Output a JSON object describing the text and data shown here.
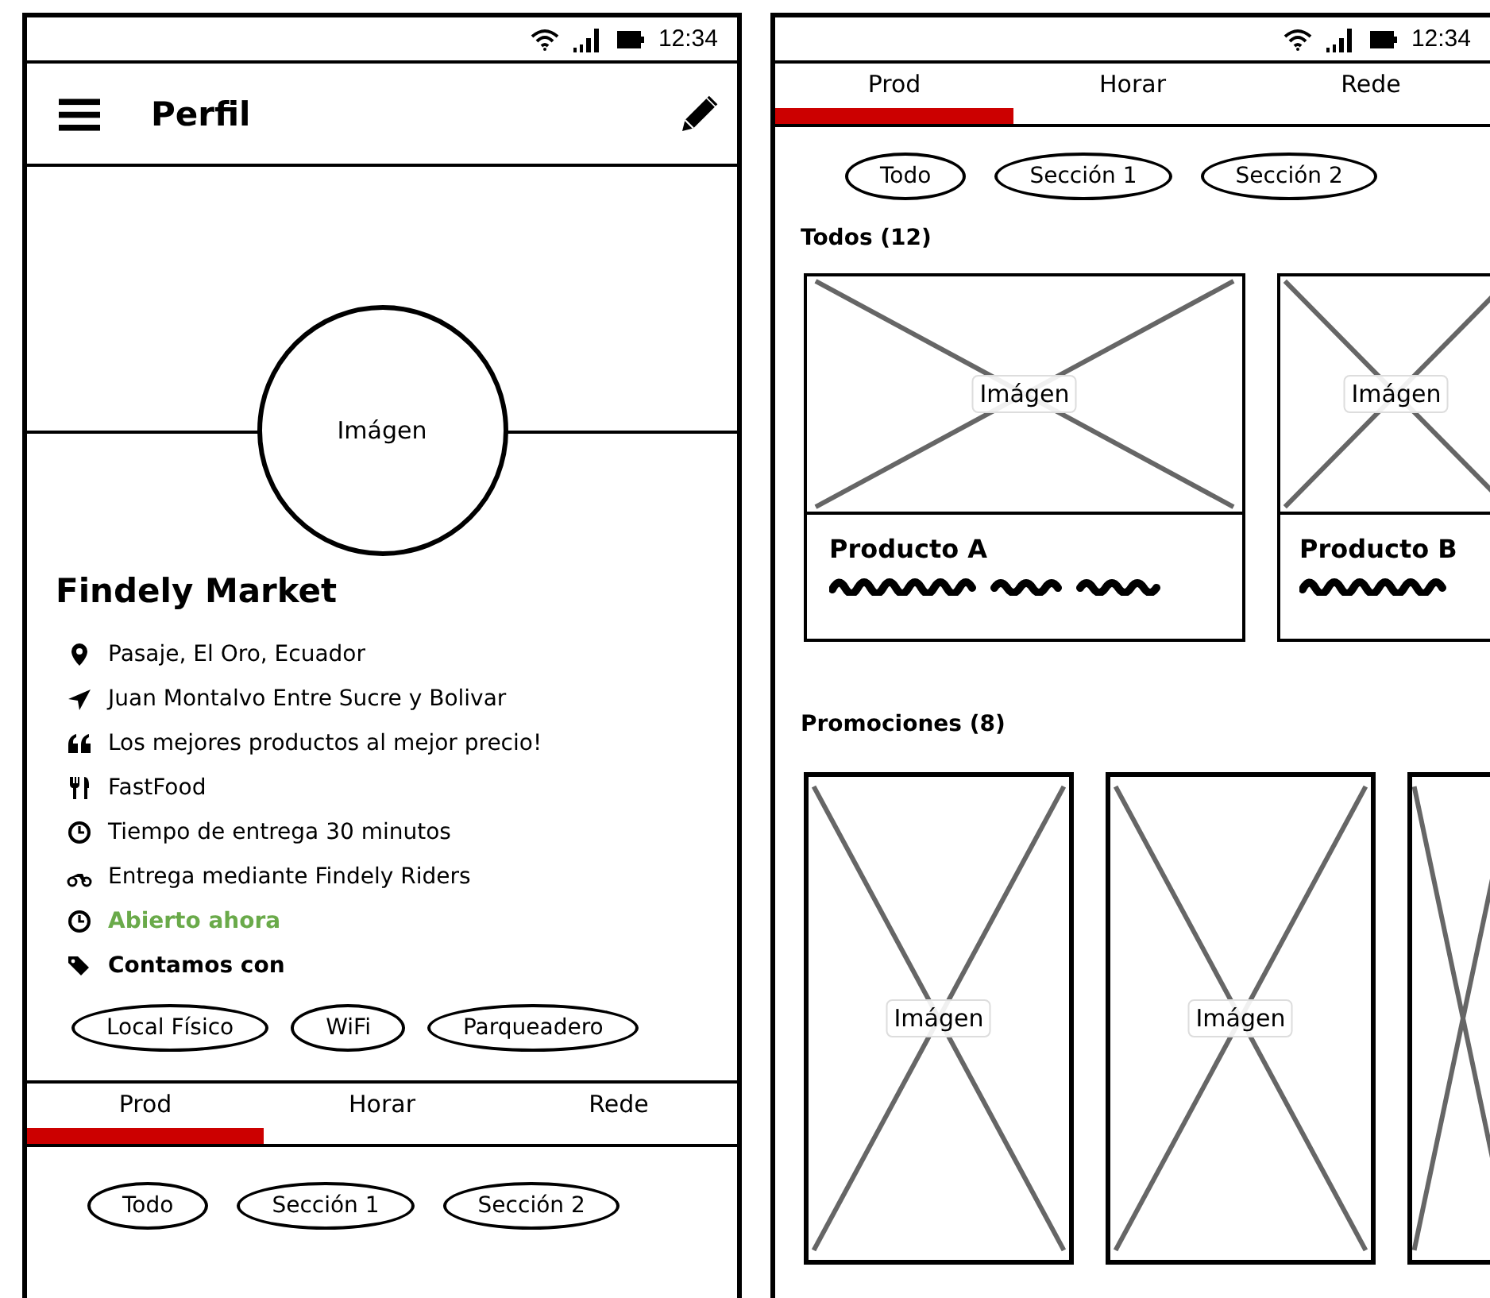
{
  "left_screen": {
    "status_bar": {
      "time": "12:34"
    },
    "header": {
      "title": "Perfil"
    },
    "profile_image": {
      "label": "Imágen"
    },
    "store_name": "Findely Market",
    "info": [
      {
        "kind": "pin",
        "text": "Pasaje, El Oro, Ecuador",
        "bold": false
      },
      {
        "kind": "navigation",
        "text": "Juan Montalvo Entre Sucre y Bolivar",
        "bold": false
      },
      {
        "kind": "quote",
        "text": "Los mejores productos al mejor precio!",
        "bold": false
      },
      {
        "kind": "cutlery",
        "text": "FastFood",
        "bold": false
      },
      {
        "kind": "clock",
        "text": "Tiempo de entrega 30 minutos",
        "bold": false
      },
      {
        "kind": "motorcycle",
        "text": "Entrega mediante Findely Riders",
        "bold": false
      },
      {
        "kind": "clock",
        "text": "Abierto ahora",
        "bold": true,
        "color": "#6aaa4a"
      },
      {
        "kind": "tags",
        "text": "Contamos con",
        "bold": true
      }
    ],
    "amenities": [
      "Local Físico",
      "WiFi",
      "Parqueadero"
    ],
    "tabs": [
      {
        "label": "Prod",
        "selected": true
      },
      {
        "label": "Horar",
        "selected": false
      },
      {
        "label": "Rede",
        "selected": false
      }
    ],
    "filters": [
      "Todo",
      "Sección 1",
      "Sección 2"
    ]
  },
  "right_screen": {
    "status_bar": {
      "time": "12:34"
    },
    "tabs": [
      {
        "label": "Prod",
        "selected": true
      },
      {
        "label": "Horar",
        "selected": false
      },
      {
        "label": "Rede",
        "selected": false
      }
    ],
    "filters": [
      "Todo",
      "Sección 1",
      "Sección 2"
    ],
    "products_heading": "Todos (12)",
    "products": [
      {
        "kind": "full",
        "image_label": "Imágen",
        "name": "Producto A"
      },
      {
        "kind": "partial",
        "image_label": "Imágen",
        "name": "Producto B"
      }
    ],
    "promotions_heading": "Promociones (8)",
    "promotions": [
      {
        "kind": "full",
        "image_label": "Imágen"
      },
      {
        "kind": "full",
        "image_label": "Imágen"
      },
      {
        "kind": "partial"
      }
    ]
  }
}
